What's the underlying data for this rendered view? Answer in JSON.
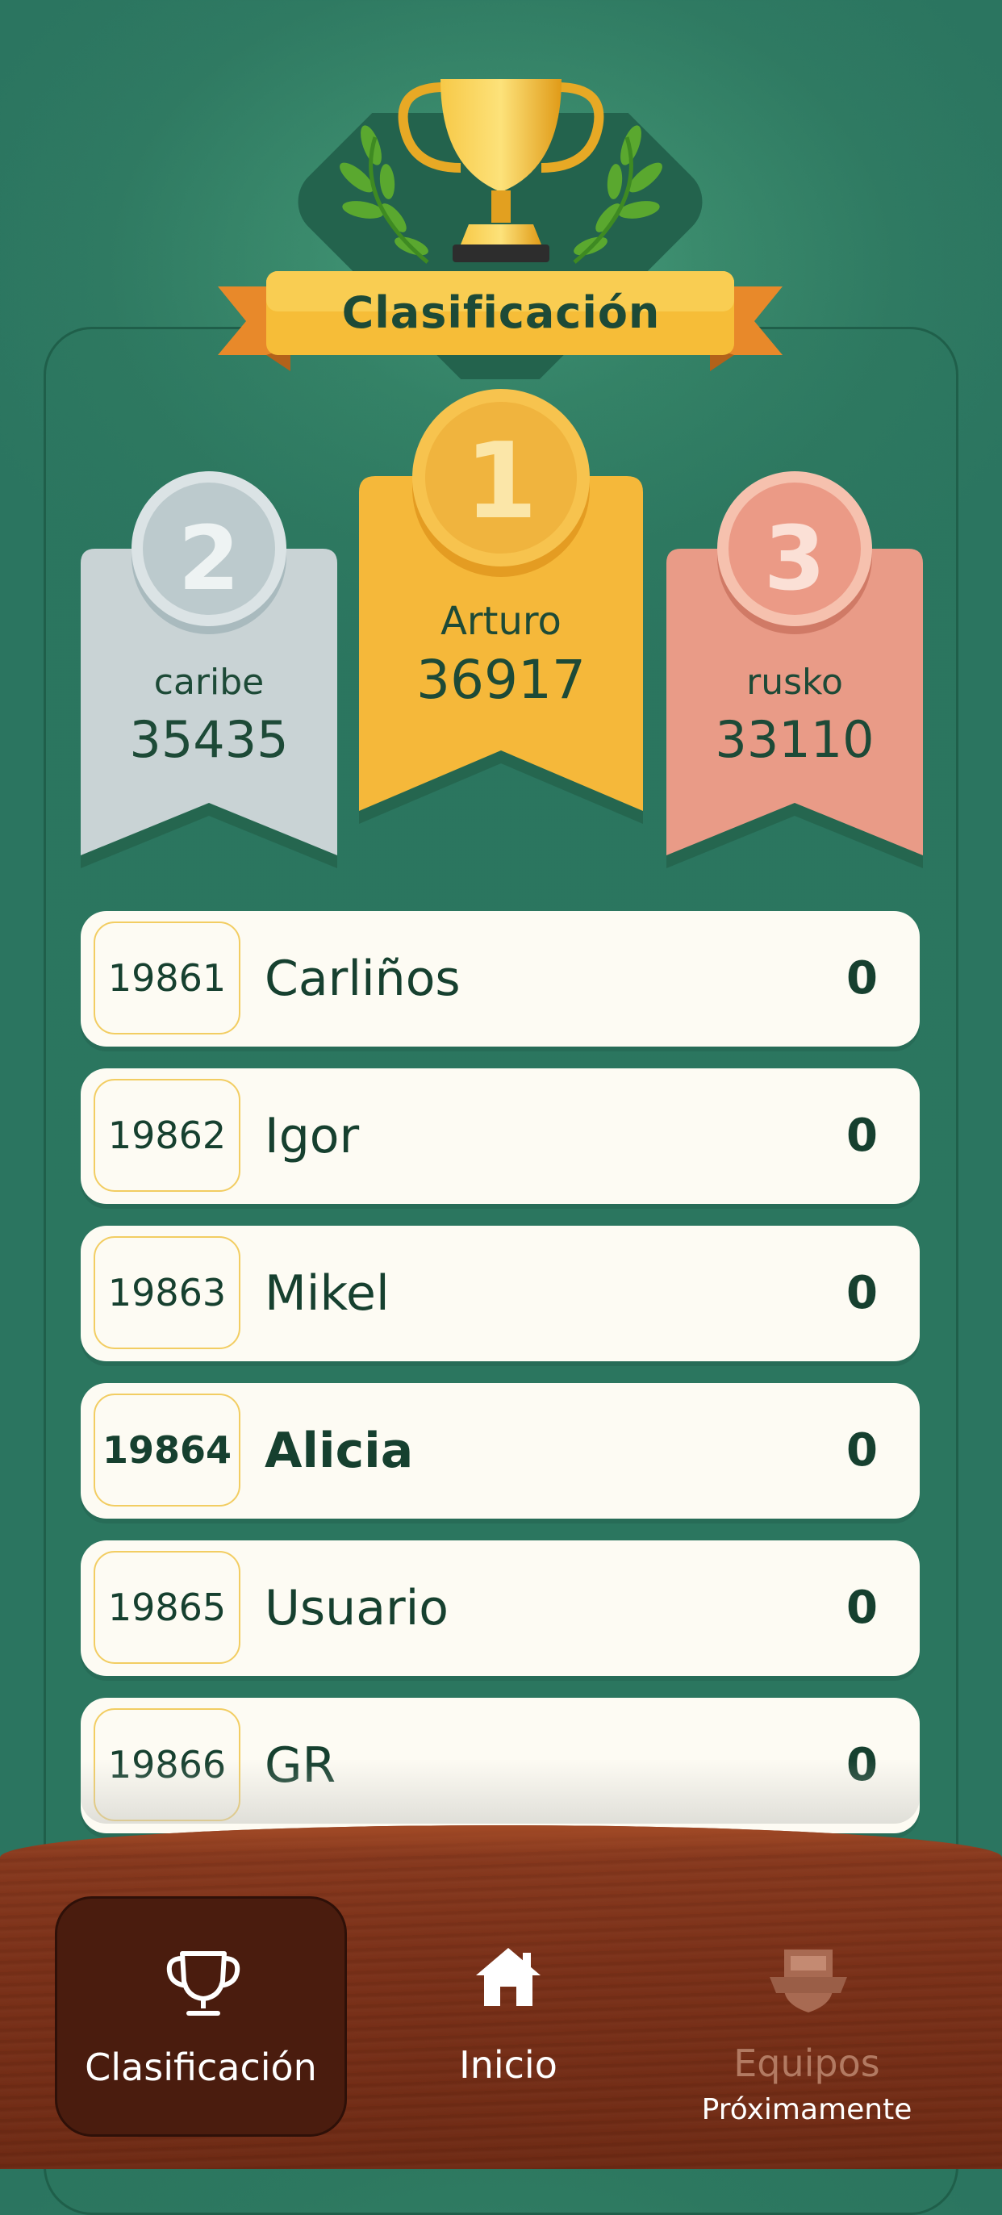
{
  "header": {
    "title": "Clasificación"
  },
  "podium": [
    {
      "rank": "2",
      "name": "caribe",
      "score": "35435",
      "color": "#c7d2d4"
    },
    {
      "rank": "1",
      "name": "Arturo",
      "score": "36917",
      "color": "#f6b834"
    },
    {
      "rank": "3",
      "name": "rusko",
      "score": "33110",
      "color": "#e99a86"
    }
  ],
  "leaderboard": [
    {
      "rank": "19861",
      "name": "Carliños",
      "score": "0"
    },
    {
      "rank": "19862",
      "name": "Igor",
      "score": "0"
    },
    {
      "rank": "19863",
      "name": "Mikel",
      "score": "0"
    },
    {
      "rank": "19864",
      "name": "Alicia",
      "score": "0",
      "current_user": true
    },
    {
      "rank": "19865",
      "name": "Usuario",
      "score": "0"
    },
    {
      "rank": "19866",
      "name": "GR",
      "score": "0"
    }
  ],
  "nav": {
    "items": [
      {
        "label": "Clasificación",
        "icon": "trophy-icon",
        "active": true
      },
      {
        "label": "Inicio",
        "icon": "home-icon",
        "active": false
      },
      {
        "label": "Equipos",
        "sublabel": "Próximamente",
        "icon": "shield-icon",
        "active": false,
        "disabled": true
      }
    ]
  }
}
